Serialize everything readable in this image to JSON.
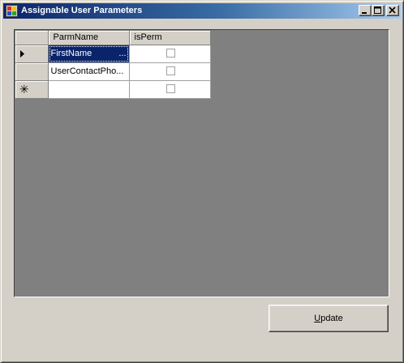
{
  "window": {
    "title": "Assignable User Parameters",
    "icon": "app-window-icon",
    "controls": [
      "minimize-icon",
      "maximize-icon",
      "close-icon"
    ]
  },
  "grid": {
    "columns": [
      "ParmName",
      "isPerm"
    ],
    "rows": [
      {
        "indicator": "current-row-arrow-icon",
        "parm_name": "FirstName",
        "ellipsis": "...",
        "is_perm": false,
        "selected": true
      },
      {
        "indicator": "",
        "parm_name": "UserContactPho...",
        "ellipsis": "",
        "is_perm": false,
        "selected": false
      },
      {
        "indicator": "new-row-asterisk-icon",
        "parm_name": "",
        "ellipsis": "",
        "is_perm": false,
        "selected": false
      }
    ],
    "new_row_glyph": "✳"
  },
  "buttons": {
    "update_label": "Update",
    "update_mnemonic": "U",
    "update_rest": "pdate"
  }
}
